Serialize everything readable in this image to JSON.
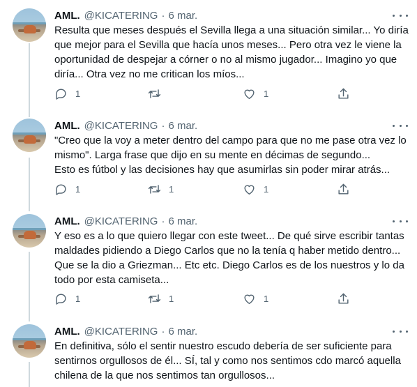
{
  "tweets": [
    {
      "name": "AML.",
      "handle": "@KICATERING",
      "separator": "·",
      "date": "6 mar.",
      "lines": [
        "Resulta que meses después el Sevilla llega a una situación similar... Yo diría",
        "que mejor para el Sevilla que hacía unos meses... Pero otra vez le viene la",
        "oportunidad de despejar a córner o no al mismo jugador... Imagino yo que",
        "diría... Otra vez no me critican los míos..."
      ],
      "replies": "1",
      "retweets": "",
      "likes": "1"
    },
    {
      "name": "AML.",
      "handle": "@KICATERING",
      "separator": "·",
      "date": "6 mar.",
      "lines": [
        "\"Creo que la voy a meter dentro del campo para que no me pase otra vez lo",
        "mismo\". Larga frase que dijo en su mente en décimas de segundo...",
        "Esto es fútbol y las decisiones hay que asumirlas sin poder mirar atrás..."
      ],
      "replies": "1",
      "retweets": "1",
      "likes": "1"
    },
    {
      "name": "AML.",
      "handle": "@KICATERING",
      "separator": "·",
      "date": "6 mar.",
      "lines": [
        "Y eso es a lo que quiero llegar con este tweet... De qué sirve escribir tantas",
        "maldades pidiendo a Diego Carlos que no la tenía q haber metido dentro...",
        "Que se la dio a Griezman... Etc etc. Diego Carlos es de los nuestros y lo da",
        "todo por esta camiseta..."
      ],
      "replies": "1",
      "retweets": "1",
      "likes": "1"
    },
    {
      "name": "AML.",
      "handle": "@KICATERING",
      "separator": "·",
      "date": "6 mar.",
      "lines": [
        "En definitiva, sólo el sentir nuestro escudo debería de ser suficiente para",
        "sentirnos orgullosos de él... SÍ, tal y como nos sentimos cdo marcó aquella",
        "chilena de la que nos sentimos tan orgullosos..."
      ],
      "replies": "",
      "retweets": "",
      "likes": ""
    }
  ],
  "icons": {
    "more": "more-horizontal-icon",
    "reply": "reply-icon",
    "retweet": "retweet-icon",
    "like": "heart-icon",
    "share": "share-icon"
  },
  "colors": {
    "text": "#0f1419",
    "secondary": "#536471",
    "thread_line": "#cfd9de"
  }
}
